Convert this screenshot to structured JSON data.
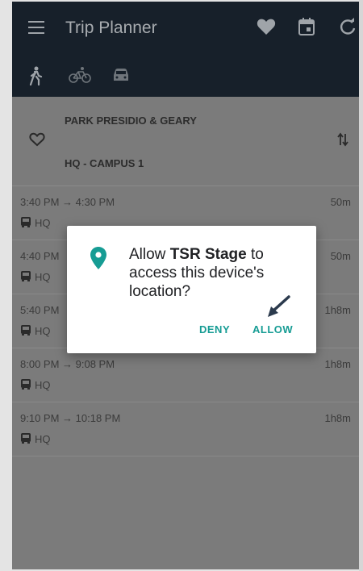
{
  "appbar": {
    "title": "Trip Planner",
    "menu_icon": "hamburger-menu-icon",
    "actions": [
      "heart-icon",
      "calendar-icon",
      "refresh-icon"
    ]
  },
  "modes": [
    "walk-icon",
    "bike-icon",
    "car-icon"
  ],
  "route": {
    "from": "PARK PRESIDIO & GEARY",
    "to": "HQ - CAMPUS 1",
    "favorite_icon": "heart-outline-icon",
    "swap_icon": "swap-vertical-icon"
  },
  "trips": [
    {
      "time": "3:40 PM → 4:30 PM",
      "duration": "50m",
      "destination": "HQ"
    },
    {
      "time": "4:40 PM",
      "duration": "50m",
      "destination": "HQ"
    },
    {
      "time": "5:40 PM",
      "duration": "1h8m",
      "destination": "HQ"
    },
    {
      "time": "8:00 PM → 9:08 PM",
      "duration": "1h8m",
      "destination": "HQ"
    },
    {
      "time": "9:10 PM → 10:18 PM",
      "duration": "1h8m",
      "destination": "HQ"
    }
  ],
  "dialog": {
    "message_prefix": "Allow ",
    "app_name": "TSR Stage",
    "message_suffix": " to access this device's location?",
    "deny_label": "DENY",
    "allow_label": "ALLOW",
    "icon": "location-pin-icon",
    "accent_color": "#169c94"
  },
  "colors": {
    "appbar_bg": "#17202a",
    "scrim_bg": "#7b7b7b"
  }
}
